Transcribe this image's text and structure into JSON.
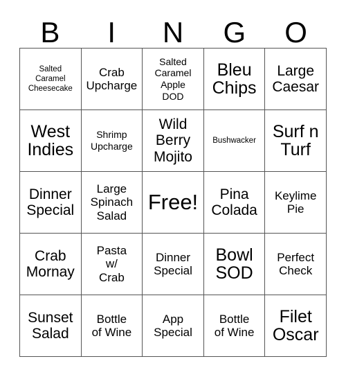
{
  "card": {
    "header_letters": [
      "B",
      "I",
      "N",
      "G",
      "O"
    ],
    "grid": {
      "rows": 5,
      "columns": 5,
      "border_color": "#555555",
      "background_color": "#ffffff",
      "text_color": "#000000"
    },
    "cells": [
      {
        "text": "Salted\nCaramel\nCheesecake",
        "size": "fs-xs",
        "column": "B",
        "row": 1
      },
      {
        "text": "Crab\nUpcharge",
        "size": "fs-md",
        "column": "I",
        "row": 1
      },
      {
        "text": "Salted\nCaramel\nApple\nDOD",
        "size": "fs-sm",
        "column": "N",
        "row": 1
      },
      {
        "text": "Bleu\nChips",
        "size": "fs-xl",
        "column": "G",
        "row": 1
      },
      {
        "text": "Large\nCaesar",
        "size": "fs-lg",
        "column": "O",
        "row": 1
      },
      {
        "text": "West\nIndies",
        "size": "fs-xl",
        "column": "B",
        "row": 2
      },
      {
        "text": "Shrimp\nUpcharge",
        "size": "fs-sm",
        "column": "I",
        "row": 2
      },
      {
        "text": "Wild\nBerry\nMojito",
        "size": "fs-lg",
        "column": "N",
        "row": 2
      },
      {
        "text": "Bushwacker",
        "size": "fs-xs",
        "column": "G",
        "row": 2
      },
      {
        "text": "Surf n\nTurf",
        "size": "fs-xl",
        "column": "O",
        "row": 2
      },
      {
        "text": "Dinner\nSpecial",
        "size": "fs-lg",
        "column": "B",
        "row": 3
      },
      {
        "text": "Large\nSpinach\nSalad",
        "size": "fs-md",
        "column": "I",
        "row": 3
      },
      {
        "text": "Free!",
        "size": "fs-xxl",
        "column": "N",
        "row": 3
      },
      {
        "text": "Pina\nColada",
        "size": "fs-lg",
        "column": "G",
        "row": 3
      },
      {
        "text": "Keylime\nPie",
        "size": "fs-md",
        "column": "O",
        "row": 3
      },
      {
        "text": "Crab\nMornay",
        "size": "fs-lg",
        "column": "B",
        "row": 4
      },
      {
        "text": "Pasta\nw/\nCrab",
        "size": "fs-md",
        "column": "I",
        "row": 4
      },
      {
        "text": "Dinner\nSpecial",
        "size": "fs-md",
        "column": "N",
        "row": 4
      },
      {
        "text": "Bowl\nSOD",
        "size": "fs-xl",
        "column": "G",
        "row": 4
      },
      {
        "text": "Perfect\nCheck",
        "size": "fs-md",
        "column": "O",
        "row": 4
      },
      {
        "text": "Sunset\nSalad",
        "size": "fs-lg",
        "column": "B",
        "row": 5
      },
      {
        "text": "Bottle\nof Wine",
        "size": "fs-md",
        "column": "I",
        "row": 5
      },
      {
        "text": "App\nSpecial",
        "size": "fs-md",
        "column": "N",
        "row": 5
      },
      {
        "text": "Bottle\nof Wine",
        "size": "fs-md",
        "column": "G",
        "row": 5
      },
      {
        "text": "Filet\nOscar",
        "size": "fs-xl",
        "column": "O",
        "row": 5
      }
    ]
  }
}
